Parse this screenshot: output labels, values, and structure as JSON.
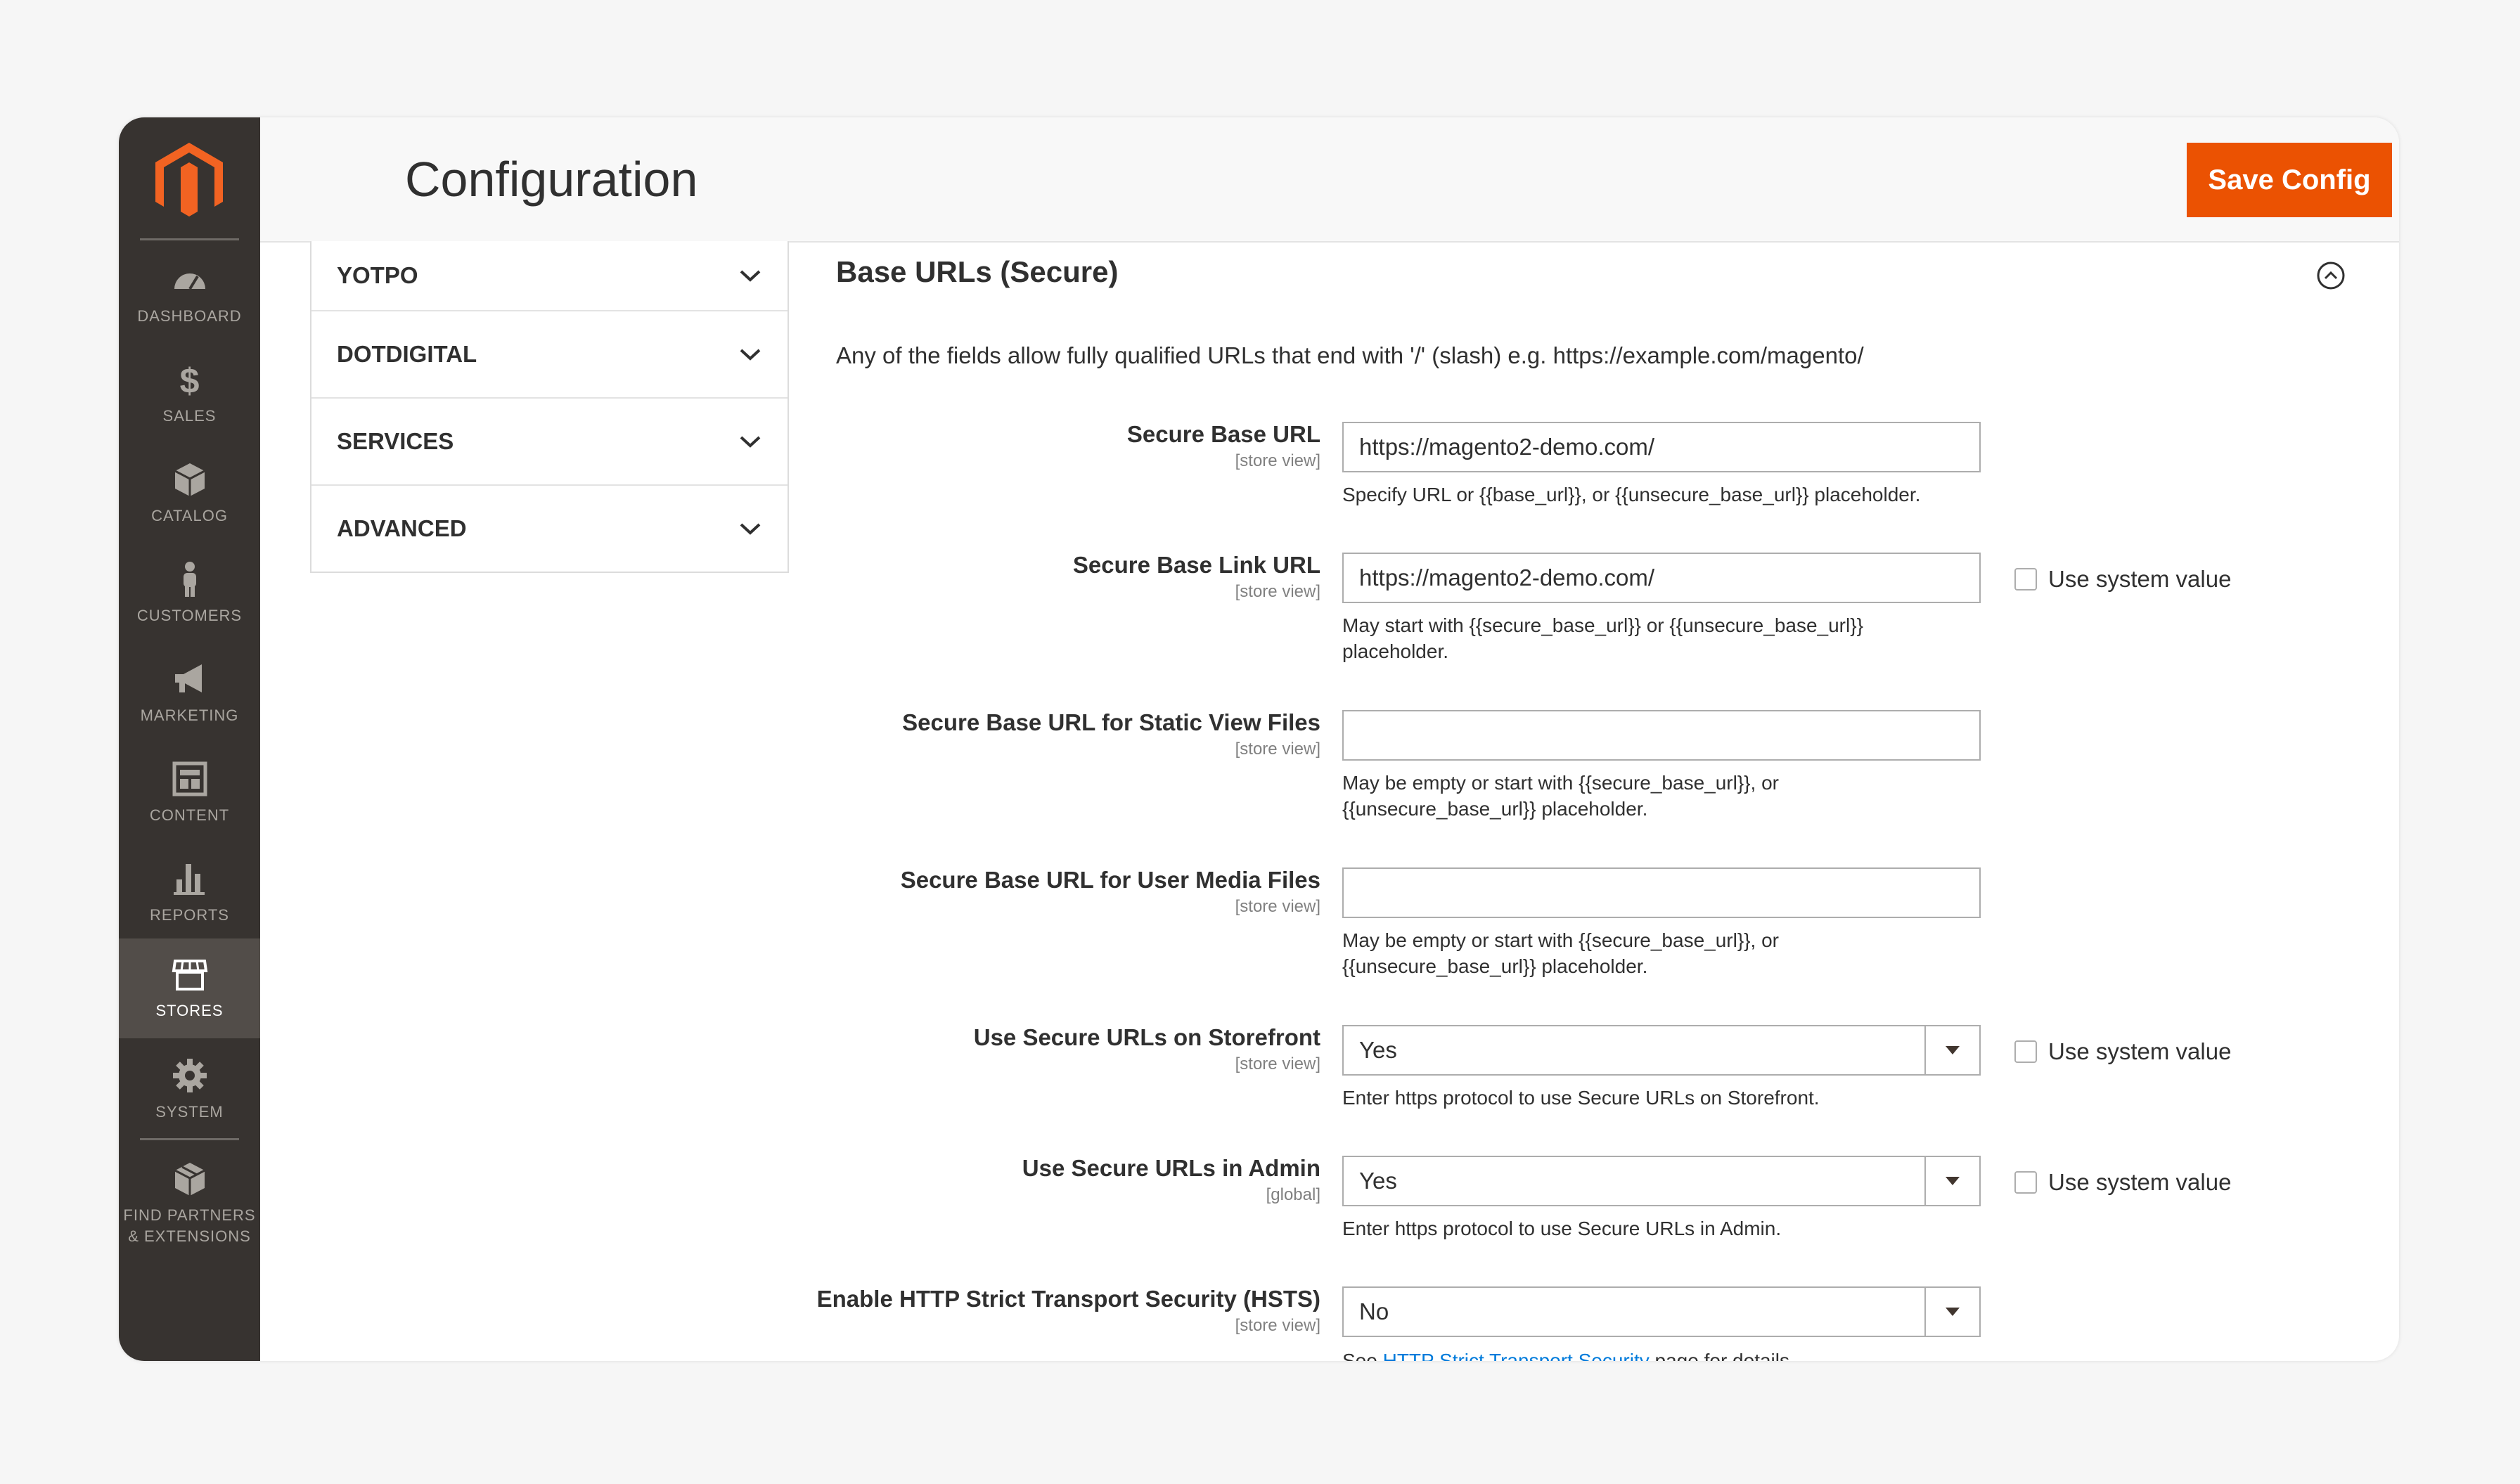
{
  "sidebar": {
    "items": [
      {
        "label": "DASHBOARD",
        "icon": "dashboard-icon"
      },
      {
        "label": "SALES",
        "icon": "dollar-icon"
      },
      {
        "label": "CATALOG",
        "icon": "cube-icon"
      },
      {
        "label": "CUSTOMERS",
        "icon": "person-icon"
      },
      {
        "label": "MARKETING",
        "icon": "megaphone-icon"
      },
      {
        "label": "CONTENT",
        "icon": "layout-icon"
      },
      {
        "label": "REPORTS",
        "icon": "bar-chart-icon"
      },
      {
        "label": "STORES",
        "icon": "storefront-icon"
      },
      {
        "label": "SYSTEM",
        "icon": "gear-icon"
      },
      {
        "label": "FIND PARTNERS & EXTENSIONS",
        "icon": "extensions-icon"
      }
    ],
    "active": "STORES"
  },
  "header": {
    "title": "Configuration",
    "save_label": "Save Config"
  },
  "tabs": [
    {
      "label": "YOTPO"
    },
    {
      "label": "DOTDIGITAL"
    },
    {
      "label": "SERVICES"
    },
    {
      "label": "ADVANCED"
    }
  ],
  "section": {
    "title": "Base URLs (Secure)",
    "intro": "Any of the fields allow fully qualified URLs that end with '/' (slash) e.g. https://example.com/magento/"
  },
  "fields": {
    "secure_base_url": {
      "label": "Secure Base URL",
      "scope": "[store view]",
      "value": "https://magento2-demo.com/",
      "note": "Specify URL or {{base_url}}, or {{unsecure_base_url}} placeholder."
    },
    "secure_base_link_url": {
      "label": "Secure Base Link URL",
      "scope": "[store view]",
      "value": "https://magento2-demo.com/",
      "note_line1": "May start with {{secure_base_url}} or {{unsecure_base_url}}",
      "note_line2": "placeholder.",
      "system_value": "Use system value"
    },
    "static_view": {
      "label": "Secure Base URL for Static View Files",
      "scope": "[store view]",
      "value": "",
      "note_line1": "May be empty or start with {{secure_base_url}}, or",
      "note_line2": "{{unsecure_base_url}} placeholder."
    },
    "user_media": {
      "label": "Secure Base URL for User Media Files",
      "scope": "[store view]",
      "value": "",
      "note_line1": "May be empty or start with {{secure_base_url}}, or",
      "note_line2": "{{unsecure_base_url}} placeholder."
    },
    "secure_storefront": {
      "label": "Use Secure URLs on Storefront",
      "scope": "[store view]",
      "value": "Yes",
      "note": "Enter https protocol to use Secure URLs on Storefront.",
      "system_value": "Use system value"
    },
    "secure_admin": {
      "label": "Use Secure URLs in Admin",
      "scope": "[global]",
      "value": "Yes",
      "note": "Enter https protocol to use Secure URLs in Admin.",
      "system_value": "Use system value"
    },
    "hsts": {
      "label": "Enable HTTP Strict Transport Security (HSTS)",
      "scope": "[store view]",
      "value": "No",
      "note_prefix": "See ",
      "note_link": "HTTP Strict Transport Security",
      "note_suffix": " page for details."
    }
  },
  "colors": {
    "accent": "#eb5202",
    "sidebar": "#373330",
    "sidebar_active": "#524d49",
    "link": "#007bdb"
  }
}
